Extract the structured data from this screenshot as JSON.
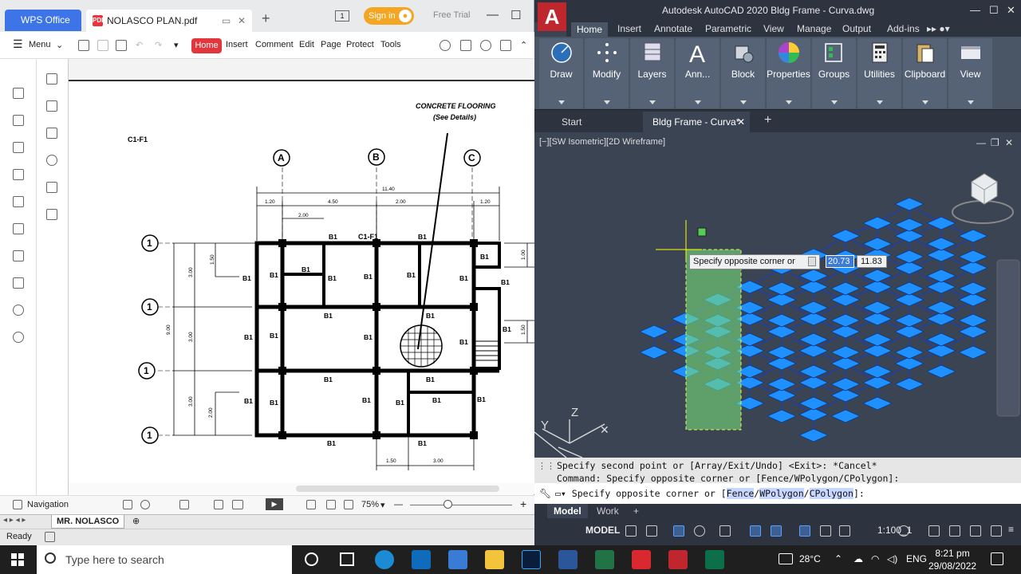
{
  "wps": {
    "logo_tab": "WPS Office",
    "doc_tab": "NOLASCO PLAN.pdf",
    "pdf_badge": "PDF",
    "signin": "Sign in",
    "free_trial": "Free Trial",
    "menu_label": "Menu",
    "menu_items": [
      "Home",
      "Insert",
      "Comment",
      "Edit",
      "Page",
      "Protect",
      "Tools"
    ],
    "navigation": "Navigation",
    "zoom": "75%",
    "sheet_tab": "MR. NOLASCO",
    "ready": "Ready"
  },
  "drawing": {
    "concrete_title": "CONCRETE FLOORING",
    "concrete_sub": "(See Details)",
    "label_c1f1": "C1-F1",
    "axes_letters": [
      "A",
      "B",
      "C"
    ],
    "axis_numbers": [
      "1",
      "1",
      "1",
      "1"
    ],
    "dims_top": [
      "11.40",
      "1.20",
      "4.50",
      "2.00",
      "1.20",
      "2.00"
    ],
    "dims_left": [
      "9.00",
      "3.00",
      "3.00",
      "3.00",
      "1.50",
      "2.00"
    ],
    "dims_right": [
      "1.00",
      "1.50"
    ],
    "dims_bottom": [
      "1.50",
      "3.00"
    ],
    "beam": "B1"
  },
  "acad": {
    "title": "Autodesk AutoCAD 2020   Bldg Frame - Curva.dwg",
    "logo": "A",
    "ribbon_tabs": [
      "Home",
      "Insert",
      "Annotate",
      "Parametric",
      "View",
      "Manage",
      "Output",
      "Add-ins"
    ],
    "panels": [
      "Draw",
      "Modify",
      "Layers",
      "Ann...",
      "Block",
      "Properties",
      "Groups",
      "Utilities",
      "Clipboard",
      "View"
    ],
    "start_tab": "Start",
    "doc_tab": "Bldg Frame - Curva*",
    "viewport_label": "[−][SW Isometric][2D Wireframe]",
    "tooltip": "Specify opposite corner or",
    "dyn_value1": "20.73",
    "dyn_value2": "11.83",
    "cmd_hist1": "Specify second point or [Array/Exit/Undo] <Exit>: *Cancel*",
    "cmd_hist2": "Command: Specify opposite corner or [Fence/WPolygon/CPolygon]:",
    "cmd_in_pre": "Specify opposite corner or [",
    "cmd_in_f": "Fence",
    "cmd_in_w": "WPolygon",
    "cmd_in_c": "CPolygon",
    "cmd_in_post": "]:",
    "layout_tabs": [
      "Model",
      "Work"
    ],
    "status_model": "MODEL",
    "scale": "1:100_1",
    "ucs_z": "Z",
    "ucs_y": "Y"
  },
  "taskbar": {
    "search_placeholder": "Type here to search",
    "temp": "28°C",
    "lang": "ENG",
    "time": "8:21 pm",
    "date": "29/08/2022"
  }
}
